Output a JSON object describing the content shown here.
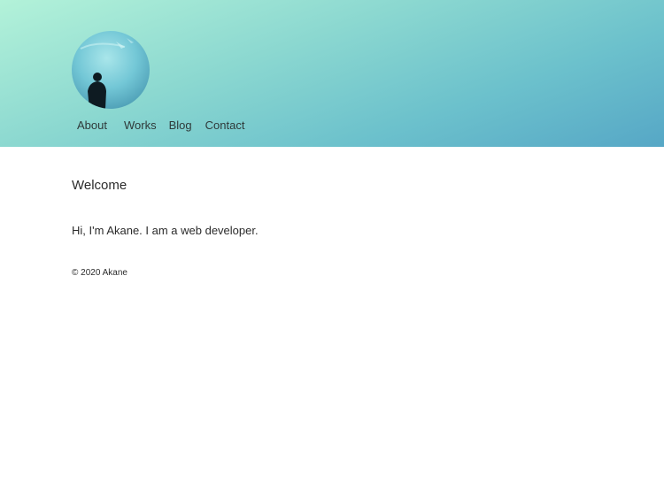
{
  "header": {
    "avatar_icon": "profile-photo-silhouette-aquarium",
    "nav": [
      {
        "label": "About"
      },
      {
        "label": "Works"
      },
      {
        "label": "Blog"
      },
      {
        "label": "Contact"
      }
    ]
  },
  "main": {
    "title": "Welcome",
    "intro": "Hi, I'm Akane. I am a web developer."
  },
  "footer": {
    "copyright": "© 2020 Akane"
  },
  "colors": {
    "header_gradient_start": "#b3f2d9",
    "header_gradient_end": "#56a7c6",
    "text": "#2b2b2b"
  }
}
